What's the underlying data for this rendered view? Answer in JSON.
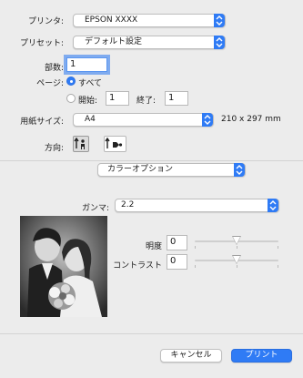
{
  "printer": {
    "label": "プリンタ:",
    "value": "EPSON XXXX"
  },
  "preset": {
    "label": "プリセット:",
    "value": "デフォルト設定"
  },
  "copies": {
    "label": "部数:",
    "value": "1"
  },
  "pages": {
    "label": "ページ:",
    "all_label": "すべて",
    "from_label": "開始:",
    "from_value": "1",
    "to_label": "終了:",
    "to_value": "1",
    "selected": "all"
  },
  "paper_size": {
    "label": "用紙サイズ:",
    "value": "A4",
    "dimensions": "210 x 297 mm"
  },
  "orientation": {
    "label": "方向:",
    "selected": "portrait"
  },
  "section": {
    "value": "カラーオプション"
  },
  "gamma": {
    "label": "ガンマ:",
    "value": "2.2"
  },
  "brightness": {
    "label": "明度",
    "value": "0",
    "level": 0.5
  },
  "contrast": {
    "label": "コントラスト",
    "value": "0",
    "level": 0.5
  },
  "buttons": {
    "cancel": "キャンセル",
    "print": "プリント"
  },
  "colors": {
    "accent": "#2f7bf5",
    "background": "#ececec"
  }
}
